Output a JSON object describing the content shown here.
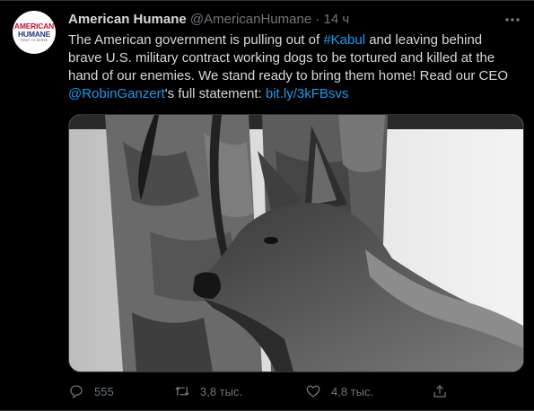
{
  "tweet": {
    "author": {
      "name": "American Humane",
      "handle": "@AmericanHumane",
      "avatar_text": {
        "line1": "AMERICAN",
        "line2": "HUMANE",
        "line3": "FIRST TO SERVE"
      }
    },
    "separator": "·",
    "time": "14 ч",
    "text": {
      "part1": "The American government is pulling out of ",
      "hashtag": "#Kabul",
      "part2": " and leaving behind brave U.S. military contract working dogs to be tortured and killed at the hand of our enemies. We stand ready to bring them home! Read our CEO ",
      "mention": "@RobinGanzert",
      "part3": "'s full statement: ",
      "url": "bit.ly/3kFBsvs"
    },
    "actions": {
      "reply_count": "555",
      "retweet_count": "3,8 тыс.",
      "like_count": "4,8 тыс."
    }
  },
  "colors": {
    "background": "#000000",
    "text": "#d9d9d9",
    "muted": "#6e767d",
    "link": "#1d9bf0",
    "divider": "#2f3336"
  },
  "icons": [
    "more-icon",
    "reply-icon",
    "retweet-icon",
    "like-icon",
    "share-icon"
  ]
}
